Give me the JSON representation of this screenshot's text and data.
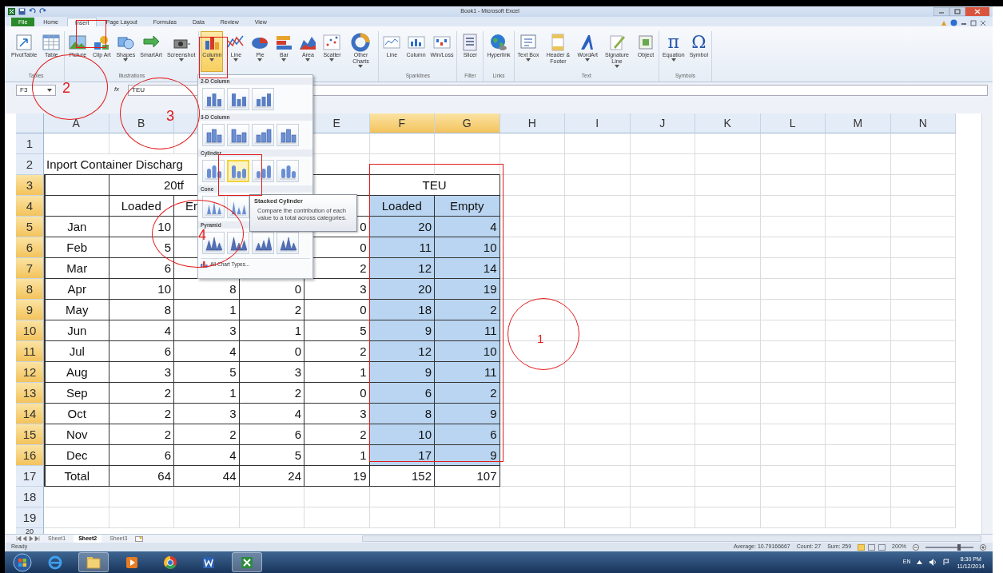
{
  "window": {
    "title": "Book1 - Microsoft Excel"
  },
  "ribbon_tabs": [
    {
      "label": "File",
      "kind": "file",
      "selected": false
    },
    {
      "label": "Home",
      "kind": "tab",
      "selected": false
    },
    {
      "label": "Insert",
      "kind": "tab",
      "selected": true
    },
    {
      "label": "Page Layout",
      "kind": "tab",
      "selected": false
    },
    {
      "label": "Formulas",
      "kind": "tab",
      "selected": false
    },
    {
      "label": "Data",
      "kind": "tab",
      "selected": false
    },
    {
      "label": "Review",
      "kind": "tab",
      "selected": false
    },
    {
      "label": "View",
      "kind": "tab",
      "selected": false
    }
  ],
  "ribbon_groups": [
    {
      "label": "Tables",
      "buttons": [
        {
          "label": "PivotTable",
          "menu": false,
          "expanded": false
        },
        {
          "label": "Table",
          "menu": false,
          "expanded": false
        }
      ]
    },
    {
      "label": "Illustrations",
      "buttons": [
        {
          "label": "Picture",
          "menu": false,
          "expanded": false
        },
        {
          "label": "Clip Art",
          "menu": false,
          "expanded": false
        },
        {
          "label": "Shapes",
          "menu": true,
          "expanded": false
        },
        {
          "label": "SmartArt",
          "menu": false,
          "expanded": false
        },
        {
          "label": "Screenshot",
          "menu": true,
          "expanded": false
        }
      ]
    },
    {
      "buttons": [
        {
          "label": "Column",
          "menu": true,
          "expanded": true
        },
        {
          "label": "Line",
          "menu": true,
          "expanded": false
        },
        {
          "label": "Pie",
          "menu": true,
          "expanded": false
        },
        {
          "label": "Bar",
          "menu": true,
          "expanded": false
        },
        {
          "label": "Area",
          "menu": true,
          "expanded": false
        },
        {
          "label": "Scatter",
          "menu": true,
          "expanded": false
        },
        {
          "label": "Other Charts",
          "menu": true,
          "expanded": false
        }
      ]
    },
    {
      "label": "Sparklines",
      "buttons": [
        {
          "label": "Line",
          "menu": false,
          "expanded": false
        },
        {
          "label": "Column",
          "menu": false,
          "expanded": false
        },
        {
          "label": "Win/Loss",
          "menu": false,
          "expanded": false
        }
      ]
    },
    {
      "label": "Filter",
      "buttons": [
        {
          "label": "Slicer",
          "menu": false,
          "expanded": false
        }
      ]
    },
    {
      "label": "Links",
      "buttons": [
        {
          "label": "Hyperlink",
          "menu": false,
          "expanded": false
        }
      ]
    },
    {
      "label": "Text",
      "buttons": [
        {
          "label": "Text Box",
          "menu": true,
          "expanded": false
        },
        {
          "label": "Header & Footer",
          "menu": false,
          "expanded": false
        },
        {
          "label": "WordArt",
          "menu": true,
          "expanded": false
        },
        {
          "label": "Signature Line",
          "menu": true,
          "expanded": false
        },
        {
          "label": "Object",
          "menu": false,
          "expanded": false
        }
      ]
    },
    {
      "label": "Symbols",
      "buttons": [
        {
          "label": "Equation",
          "glyph": "π",
          "menu": true,
          "expanded": false
        },
        {
          "label": "Symbol",
          "glyph": "Ω",
          "menu": false,
          "expanded": false
        }
      ]
    }
  ],
  "formula_bar": {
    "name_box": "F3",
    "function_label": "fx",
    "value": "TEU"
  },
  "columns": [
    {
      "label": "A",
      "selected": false
    },
    {
      "label": "B",
      "selected": false
    },
    null,
    null,
    {
      "label": "E",
      "selected": false
    },
    {
      "label": "F",
      "selected": true
    },
    {
      "label": "G",
      "selected": true
    },
    {
      "label": "H",
      "selected": false
    },
    {
      "label": "I",
      "selected": false
    },
    {
      "label": "J",
      "selected": false
    },
    {
      "label": "K",
      "selected": false
    },
    {
      "label": "L",
      "selected": false
    },
    {
      "label": "M",
      "selected": false
    },
    {
      "label": "N",
      "selected": false
    }
  ],
  "rows": [
    {
      "header": "1",
      "selected": false,
      "boxed": false,
      "cells": []
    },
    {
      "header": "2",
      "selected": false,
      "boxed": false,
      "cells": [
        {
          "text": "Inport Container Discharg",
          "kind": "title",
          "selected": false
        }
      ]
    },
    {
      "header": "3",
      "selected": true,
      "boxed": true,
      "cells": [
        null,
        {
          "text": "20tf",
          "kind": "merged",
          "selected": false
        },
        null,
        null,
        null,
        {
          "text": "TEU",
          "kind": "merged",
          "selected": false
        },
        null
      ]
    },
    {
      "header": "4",
      "selected": true,
      "boxed": true,
      "cells": [
        null,
        {
          "text": "Loaded",
          "kind": "label",
          "selected": false
        },
        {
          "text": "Er",
          "kind": "clipped",
          "selected": false
        },
        null,
        null,
        {
          "text": "Loaded",
          "kind": "label",
          "selected": true
        },
        {
          "text": "Empty",
          "kind": "label",
          "selected": true
        }
      ]
    },
    {
      "header": "5",
      "selected": true,
      "boxed": true,
      "cells": [
        {
          "text": "Jan",
          "kind": "label",
          "selected": false
        },
        {
          "text": "10",
          "kind": "number",
          "selected": false
        },
        null,
        null,
        {
          "text": "0",
          "kind": "number",
          "selected": false
        },
        {
          "text": "20",
          "kind": "number",
          "selected": true
        },
        {
          "text": "4",
          "kind": "number",
          "selected": true
        }
      ]
    },
    {
      "header": "6",
      "selected": true,
      "boxed": true,
      "cells": [
        {
          "text": "Feb",
          "kind": "label",
          "selected": false
        },
        {
          "text": "5",
          "kind": "number",
          "selected": false
        },
        null,
        null,
        {
          "text": "0",
          "kind": "number",
          "selected": false
        },
        {
          "text": "11",
          "kind": "number",
          "selected": true
        },
        {
          "text": "10",
          "kind": "number",
          "selected": true
        }
      ]
    },
    {
      "header": "7",
      "selected": true,
      "boxed": true,
      "cells": [
        {
          "text": "Mar",
          "kind": "label",
          "selected": false
        },
        {
          "text": "6",
          "kind": "number",
          "selected": false
        },
        null,
        null,
        {
          "text": "2",
          "kind": "number",
          "selected": false
        },
        {
          "text": "12",
          "kind": "number",
          "selected": true
        },
        {
          "text": "14",
          "kind": "number",
          "selected": true
        }
      ]
    },
    {
      "header": "8",
      "selected": true,
      "boxed": true,
      "cells": [
        {
          "text": "Apr",
          "kind": "label",
          "selected": false
        },
        {
          "text": "10",
          "kind": "number",
          "selected": false
        },
        {
          "text": "8",
          "kind": "number",
          "selected": false
        },
        {
          "text": "0",
          "kind": "number",
          "selected": false
        },
        {
          "text": "3",
          "kind": "number",
          "selected": false
        },
        {
          "text": "20",
          "kind": "number",
          "selected": true
        },
        {
          "text": "19",
          "kind": "number",
          "selected": true
        }
      ]
    },
    {
      "header": "9",
      "selected": true,
      "boxed": true,
      "cells": [
        {
          "text": "May",
          "kind": "label",
          "selected": false
        },
        {
          "text": "8",
          "kind": "number",
          "selected": false
        },
        {
          "text": "1",
          "kind": "number",
          "selected": false
        },
        {
          "text": "2",
          "kind": "number",
          "selected": false
        },
        {
          "text": "0",
          "kind": "number",
          "selected": false
        },
        {
          "text": "18",
          "kind": "number",
          "selected": true
        },
        {
          "text": "2",
          "kind": "number",
          "selected": true
        }
      ]
    },
    {
      "header": "10",
      "selected": true,
      "boxed": true,
      "cells": [
        {
          "text": "Jun",
          "kind": "label",
          "selected": false
        },
        {
          "text": "4",
          "kind": "number",
          "selected": false
        },
        {
          "text": "3",
          "kind": "number",
          "selected": false
        },
        {
          "text": "1",
          "kind": "number",
          "selected": false
        },
        {
          "text": "5",
          "kind": "number",
          "selected": false
        },
        {
          "text": "9",
          "kind": "number",
          "selected": true
        },
        {
          "text": "11",
          "kind": "number",
          "selected": true
        }
      ]
    },
    {
      "header": "11",
      "selected": true,
      "boxed": true,
      "cells": [
        {
          "text": "Jul",
          "kind": "label",
          "selected": false
        },
        {
          "text": "6",
          "kind": "number",
          "selected": false
        },
        {
          "text": "4",
          "kind": "number",
          "selected": false
        },
        {
          "text": "0",
          "kind": "number",
          "selected": false
        },
        {
          "text": "2",
          "kind": "number",
          "selected": false
        },
        {
          "text": "12",
          "kind": "number",
          "selected": true
        },
        {
          "text": "10",
          "kind": "number",
          "selected": true
        }
      ]
    },
    {
      "header": "12",
      "selected": true,
      "boxed": true,
      "cells": [
        {
          "text": "Aug",
          "kind": "label",
          "selected": false
        },
        {
          "text": "3",
          "kind": "number",
          "selected": false
        },
        {
          "text": "5",
          "kind": "number",
          "selected": false
        },
        {
          "text": "3",
          "kind": "number",
          "selected": false
        },
        {
          "text": "1",
          "kind": "number",
          "selected": false
        },
        {
          "text": "9",
          "kind": "number",
          "selected": true
        },
        {
          "text": "11",
          "kind": "number",
          "selected": true
        }
      ]
    },
    {
      "header": "13",
      "selected": true,
      "boxed": true,
      "cells": [
        {
          "text": "Sep",
          "kind": "label",
          "selected": false
        },
        {
          "text": "2",
          "kind": "number",
          "selected": false
        },
        {
          "text": "1",
          "kind": "number",
          "selected": false
        },
        {
          "text": "2",
          "kind": "number",
          "selected": false
        },
        {
          "text": "0",
          "kind": "number",
          "selected": false
        },
        {
          "text": "6",
          "kind": "number",
          "selected": true
        },
        {
          "text": "2",
          "kind": "number",
          "selected": true
        }
      ]
    },
    {
      "header": "14",
      "selected": true,
      "boxed": true,
      "cells": [
        {
          "text": "Oct",
          "kind": "label",
          "selected": false
        },
        {
          "text": "2",
          "kind": "number",
          "selected": false
        },
        {
          "text": "3",
          "kind": "number",
          "selected": false
        },
        {
          "text": "4",
          "kind": "number",
          "selected": false
        },
        {
          "text": "3",
          "kind": "number",
          "selected": false
        },
        {
          "text": "8",
          "kind": "number",
          "selected": true
        },
        {
          "text": "9",
          "kind": "number",
          "selected": true
        }
      ]
    },
    {
      "header": "15",
      "selected": true,
      "boxed": true,
      "cells": [
        {
          "text": "Nov",
          "kind": "label",
          "selected": false
        },
        {
          "text": "2",
          "kind": "number",
          "selected": false
        },
        {
          "text": "2",
          "kind": "number",
          "selected": false
        },
        {
          "text": "6",
          "kind": "number",
          "selected": false
        },
        {
          "text": "2",
          "kind": "number",
          "selected": false
        },
        {
          "text": "10",
          "kind": "number",
          "selected": true
        },
        {
          "text": "6",
          "kind": "number",
          "selected": true
        }
      ]
    },
    {
      "header": "16",
      "selected": true,
      "boxed": true,
      "cells": [
        {
          "text": "Dec",
          "kind": "label",
          "selected": false
        },
        {
          "text": "6",
          "kind": "number",
          "selected": false
        },
        {
          "text": "4",
          "kind": "number",
          "selected": false
        },
        {
          "text": "5",
          "kind": "number",
          "selected": false
        },
        {
          "text": "1",
          "kind": "number",
          "selected": false
        },
        {
          "text": "17",
          "kind": "number",
          "selected": true
        },
        {
          "text": "9",
          "kind": "number",
          "selected": true
        }
      ]
    },
    {
      "header": "17",
      "selected": false,
      "boxed": true,
      "cells": [
        {
          "text": "Total",
          "kind": "label",
          "selected": false
        },
        {
          "text": "64",
          "kind": "number",
          "selected": false
        },
        {
          "text": "44",
          "kind": "number",
          "selected": false
        },
        {
          "text": "24",
          "kind": "number",
          "selected": false
        },
        {
          "text": "19",
          "kind": "number",
          "selected": false
        },
        {
          "text": "152",
          "kind": "number",
          "selected": false
        },
        {
          "text": "107",
          "kind": "number",
          "selected": false
        }
      ]
    },
    {
      "header": "18",
      "selected": false,
      "boxed": false,
      "cells": []
    },
    {
      "header": "19",
      "selected": false,
      "boxed": false,
      "cells": []
    },
    {
      "header": "20",
      "selected": false,
      "boxed": false,
      "cells": []
    }
  ],
  "chart_menu": {
    "sections": [
      {
        "title": "2-D Column",
        "kind": "column",
        "items": [
          {
            "selected": false
          },
          {
            "selected": false
          },
          {
            "selected": false
          }
        ]
      },
      {
        "title": "3-D Column",
        "kind": "column3d",
        "items": [
          {
            "selected": false
          },
          {
            "selected": false
          },
          {
            "selected": false
          },
          {
            "selected": false
          }
        ]
      },
      {
        "title": "Cylinder",
        "kind": "cylinder",
        "items": [
          {
            "selected": false
          },
          {
            "selected": true
          },
          {
            "selected": false
          },
          {
            "selected": false
          }
        ]
      },
      {
        "title": "Cone",
        "kind": "cone",
        "items": [
          {
            "selected": false
          },
          {
            "selected": false
          }
        ]
      },
      {
        "title": "Pyramid",
        "kind": "pyramid",
        "items": [
          {
            "selected": false
          },
          {
            "selected": false
          },
          {
            "selected": false
          },
          {
            "selected": false
          }
        ]
      }
    ],
    "footer": "All Chart Types..."
  },
  "tooltip": {
    "title": "Stacked Cylinder",
    "text": "Compare the contribution of each value to a total across categories."
  },
  "annotations": [
    {
      "kind": "frame"
    },
    {
      "kind": "frame"
    },
    {
      "kind": "circle",
      "label": "2"
    },
    {
      "kind": "circle",
      "label": "3"
    },
    {
      "kind": "frame"
    },
    {
      "kind": "circle",
      "label": "4"
    },
    {
      "kind": "frame"
    },
    {
      "kind": "circle",
      "label": "1"
    }
  ],
  "sheet_tabs": [
    {
      "label": "Sheet1",
      "selected": false
    },
    {
      "label": "Sheet2",
      "selected": true
    },
    {
      "label": "Sheet3",
      "selected": false
    }
  ],
  "status_bar": {
    "mode": "Ready",
    "average": "Average: 10.79166667",
    "count": "Count: 27",
    "sum": "Sum: 259",
    "view_buttons": [
      {
        "selected": true
      },
      {
        "selected": false
      },
      {
        "selected": false
      }
    ],
    "zoom": {
      "reading": "200%",
      "level": 0.7
    }
  },
  "taskbar": {
    "apps": [
      {
        "highlighted": false
      },
      {
        "highlighted": true
      },
      {
        "highlighted": false
      },
      {
        "highlighted": false
      },
      {
        "highlighted": false
      },
      {
        "highlighted": true
      }
    ],
    "language": "EN",
    "time": "8:30 PM",
    "date": "11/12/2014"
  }
}
